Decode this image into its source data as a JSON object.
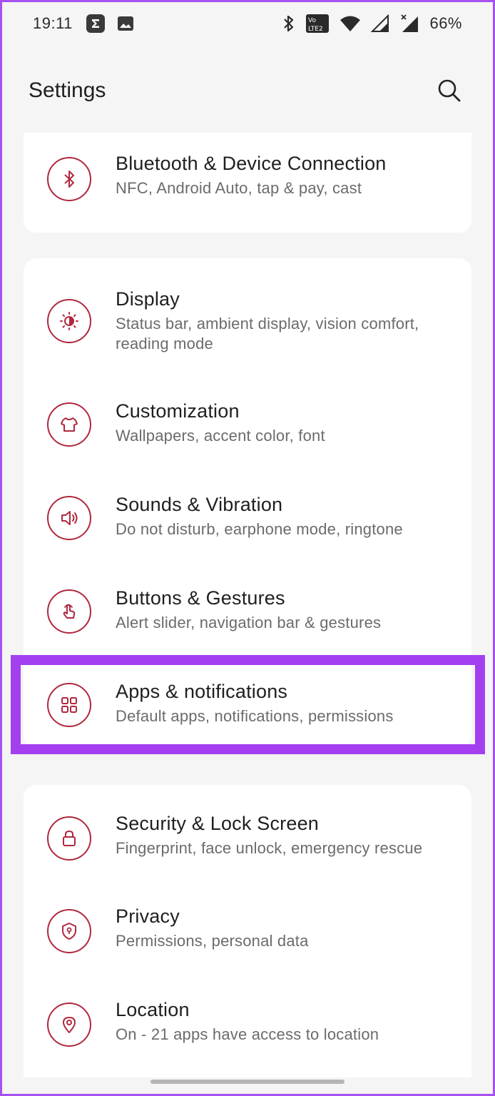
{
  "status_bar": {
    "time": "19:11",
    "battery_text": "66%",
    "icons": [
      "notification-sigma-icon",
      "notification-image-icon",
      "bluetooth-icon",
      "volte-icon",
      "wifi-icon",
      "signal-icon",
      "signal-no-data-icon"
    ]
  },
  "app_bar": {
    "title": "Settings",
    "search_icon": "search-icon"
  },
  "settings": {
    "bluetooth": {
      "title": "Bluetooth & Device Connection",
      "subtitle": "NFC, Android Auto, tap & pay, cast",
      "icon": "bluetooth-icon"
    },
    "display": {
      "title": "Display",
      "subtitle": "Status bar, ambient display, vision comfort, reading mode",
      "icon": "brightness-icon"
    },
    "customization": {
      "title": "Customization",
      "subtitle": "Wallpapers, accent color, font",
      "icon": "shirt-icon"
    },
    "sounds": {
      "title": "Sounds & Vibration",
      "subtitle": "Do not disturb, earphone mode, ringtone",
      "icon": "speaker-icon"
    },
    "buttons": {
      "title": "Buttons & Gestures",
      "subtitle": "Alert slider, navigation bar & gestures",
      "icon": "gesture-icon"
    },
    "apps": {
      "title": "Apps & notifications",
      "subtitle": "Default apps, notifications, permissions",
      "icon": "apps-grid-icon",
      "highlighted": true
    },
    "security": {
      "title": "Security & Lock Screen",
      "subtitle": "Fingerprint, face unlock, emergency rescue",
      "icon": "lock-icon"
    },
    "privacy": {
      "title": "Privacy",
      "subtitle": "Permissions, personal data",
      "icon": "shield-icon"
    },
    "location": {
      "title": "Location",
      "subtitle": "On - 21 apps have access to location",
      "icon": "location-pin-icon"
    }
  },
  "colors": {
    "accent": "#b0283f",
    "highlight": "#a43ff0",
    "background": "#f5f5f5",
    "card": "#ffffff"
  }
}
